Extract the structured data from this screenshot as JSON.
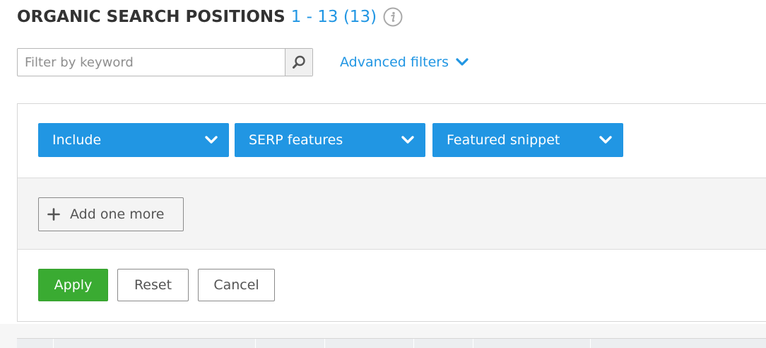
{
  "header": {
    "title": "ORGANIC SEARCH POSITIONS",
    "range": "1 - 13 (13)",
    "info_icon": "info-icon"
  },
  "filter": {
    "placeholder": "Filter by keyword",
    "value": "",
    "search_icon": "search-icon"
  },
  "advanced_filters": {
    "label": "Advanced filters",
    "icon": "chevron-down-icon"
  },
  "filter_rule": {
    "include": "Include",
    "field": "SERP features",
    "value": "Featured snippet"
  },
  "add_more": {
    "label": "Add one more",
    "icon": "plus-icon"
  },
  "actions": {
    "apply": "Apply",
    "reset": "Reset",
    "cancel": "Cancel"
  },
  "colors": {
    "accent": "#2196e3",
    "apply": "#3aab32"
  }
}
